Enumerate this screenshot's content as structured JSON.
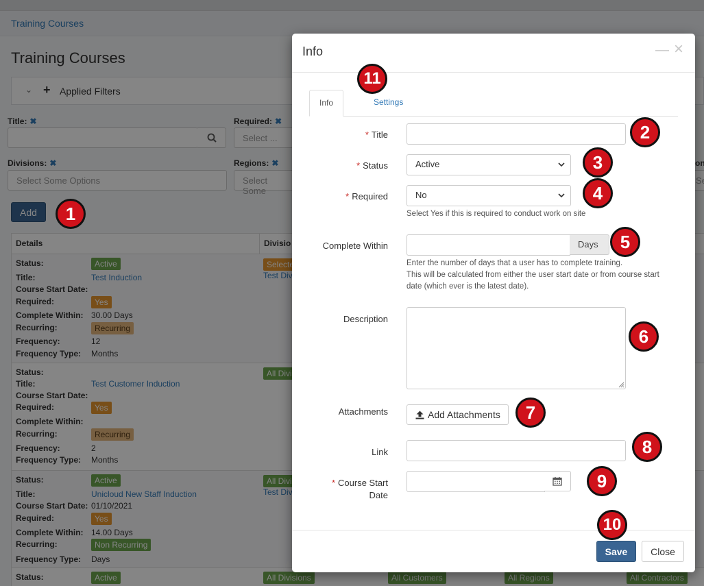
{
  "breadcrumb": "Training Courses",
  "page_title": "Training Courses",
  "filters": {
    "toggle_label": "Applied Filters",
    "title_label": "Title:",
    "required_label": "Required:",
    "required_placeholder": "Select ...",
    "divisions_label": "Divisions:",
    "divisions_placeholder": "Select Some Options",
    "regions_label": "Regions:",
    "regions_placeholder": "Select Some",
    "contractors_label_fragment": "ont",
    "contractors_placeholder_fragment": "Se"
  },
  "add_button": "Add",
  "table": {
    "headers": [
      "Details",
      "Divisio"
    ],
    "rows": [
      {
        "fields": [
          {
            "label": "Status:",
            "value": "Active",
            "kind": "badge-green"
          },
          {
            "label": "Title:",
            "value": "Test Induction",
            "kind": "link"
          },
          {
            "label": "Course Start Date:",
            "value": "",
            "kind": "text"
          },
          {
            "label": "Required:",
            "value": "Yes",
            "kind": "badge-orange"
          },
          {
            "label": "Complete Within:",
            "value": "30.00 Days",
            "kind": "text"
          },
          {
            "label": "Recurring:",
            "value": "Recurring",
            "kind": "badge-tan"
          },
          {
            "label": "Frequency:",
            "value": "12",
            "kind": "text"
          },
          {
            "label": "Frequency Type:",
            "value": "Months",
            "kind": "text"
          }
        ],
        "division_badge": "Selecte",
        "division_link": "Test Divi"
      },
      {
        "fields": [
          {
            "label": "Status:",
            "value": "",
            "kind": "text"
          },
          {
            "label": "Title:",
            "value": "Test Customer Induction",
            "kind": "link"
          },
          {
            "label": "Course Start Date:",
            "value": "",
            "kind": "text"
          },
          {
            "label": "Required:",
            "value": "Yes",
            "kind": "badge-orange"
          },
          {
            "label": "Complete Within:",
            "value": "",
            "kind": "text"
          },
          {
            "label": "Recurring:",
            "value": "Recurring",
            "kind": "badge-tan"
          },
          {
            "label": "Frequency:",
            "value": "2",
            "kind": "text"
          },
          {
            "label": "Frequency Type:",
            "value": "Months",
            "kind": "text"
          }
        ],
        "division_badge": "All Divis",
        "division_link": ""
      },
      {
        "fields": [
          {
            "label": "Status:",
            "value": "Active",
            "kind": "badge-green"
          },
          {
            "label": "Title:",
            "value": "Unicloud New Staff Induction",
            "kind": "link"
          },
          {
            "label": "Course Start Date:",
            "value": "01/10/2021",
            "kind": "text"
          },
          {
            "label": "Required:",
            "value": "Yes",
            "kind": "badge-orange"
          },
          {
            "label": "Complete Within:",
            "value": "14.00 Days",
            "kind": "text"
          },
          {
            "label": "Recurring:",
            "value": "Non Recurring",
            "kind": "badge-green"
          },
          {
            "label": "Frequency Type:",
            "value": "Days",
            "kind": "text"
          }
        ],
        "division_badge": "All Divis",
        "division_link": "Test Divi"
      }
    ],
    "last_row": {
      "status_label": "Status:",
      "status_value": "Active",
      "badges": [
        "All Divisions",
        "All Customers",
        "All Regions",
        "All Contractors"
      ]
    }
  },
  "modal": {
    "title": "Info",
    "minimize_icon": "—",
    "close_icon": "×",
    "tabs": [
      {
        "label": "Info",
        "active": true
      },
      {
        "label": "Settings",
        "active": false
      }
    ],
    "fields": {
      "title": {
        "label": "Title",
        "required": true,
        "value": ""
      },
      "status": {
        "label": "Status",
        "required": true,
        "value": "Active"
      },
      "required": {
        "label": "Required",
        "required": true,
        "value": "No",
        "help": "Select Yes if this is required to conduct work on site"
      },
      "complete_within": {
        "label": "Complete Within",
        "value": "",
        "addon": "Days",
        "help_lines": [
          "Enter the number of days that a user has to complete training.",
          "This will be calculated from either the user start date or from course start",
          "date (which ever is the latest date)."
        ]
      },
      "description": {
        "label": "Description",
        "value": ""
      },
      "attachments": {
        "label": "Attachments",
        "button": "Add Attachments"
      },
      "link": {
        "label": "Link",
        "value": ""
      },
      "course_start_date": {
        "label_line1": "Course Start",
        "label_line2": "Date",
        "required": true,
        "value": ""
      }
    },
    "footer": {
      "save": "Save",
      "close": "Close"
    }
  },
  "markers": [
    "1",
    "2",
    "3",
    "4",
    "5",
    "6",
    "7",
    "8",
    "9",
    "10",
    "11"
  ],
  "colors": {
    "primary": "#3a6593",
    "link": "#337ab7",
    "required": "#c9302c",
    "marker": "#d0121b",
    "badge_green": "#6ba54e",
    "badge_orange": "#e6962f",
    "badge_tan": "#e4b67d"
  }
}
